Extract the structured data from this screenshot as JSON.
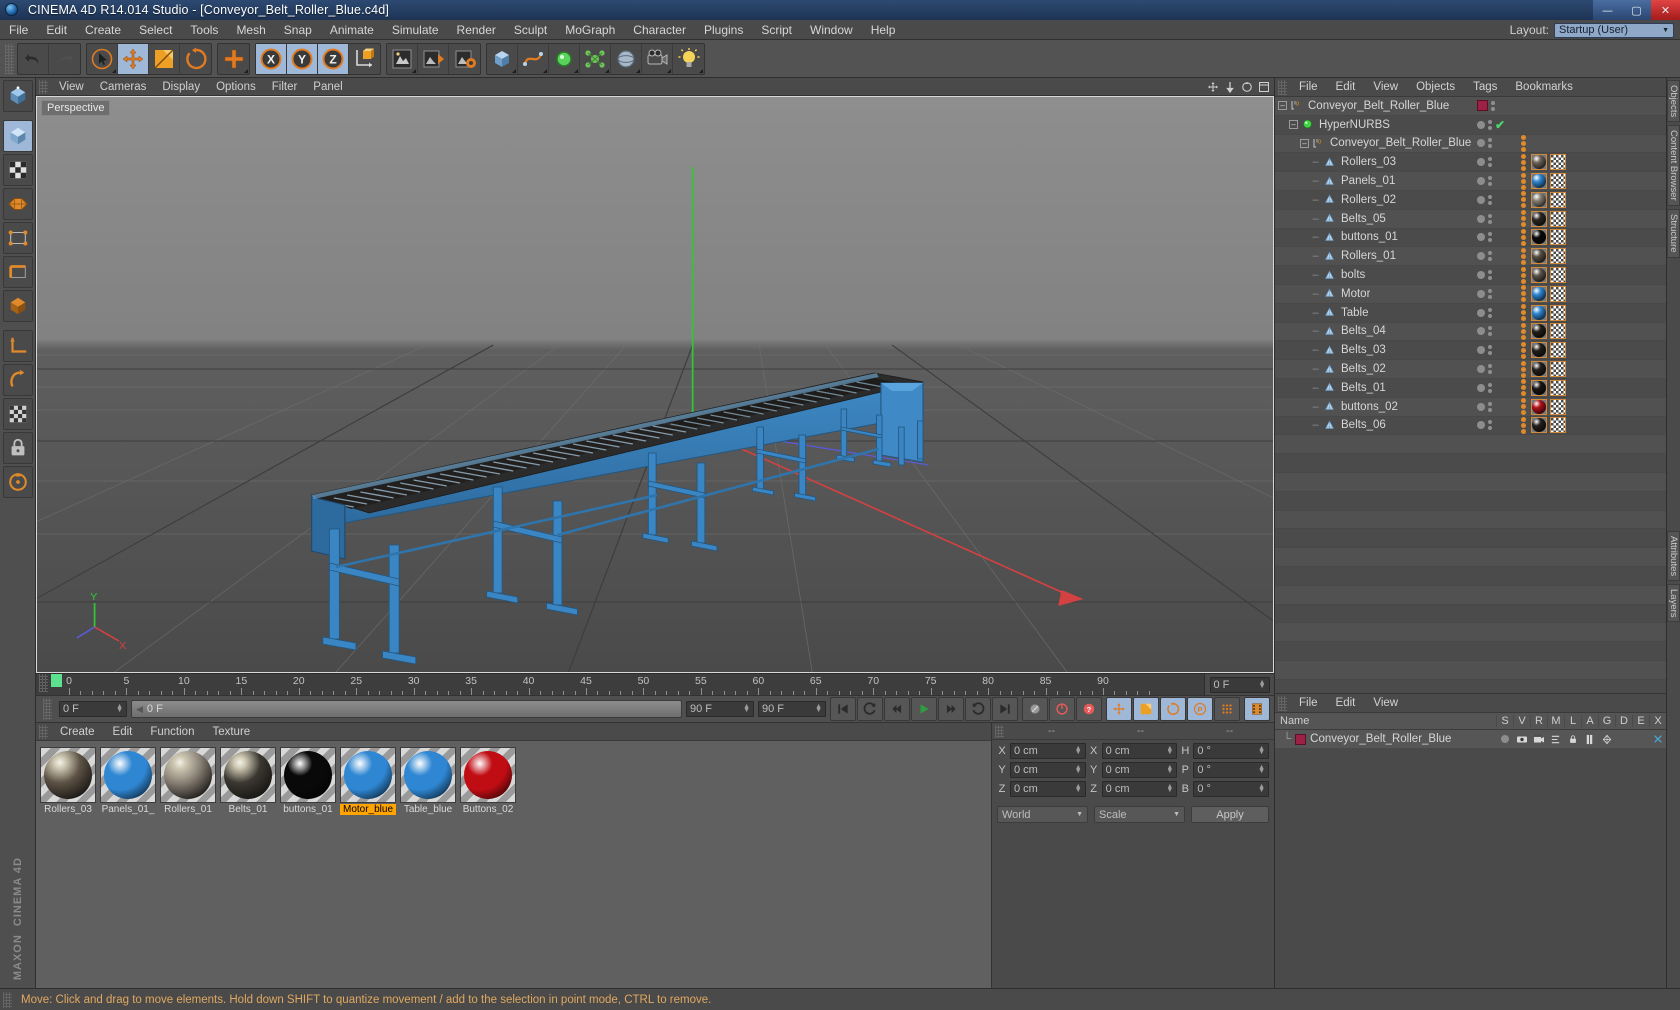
{
  "titlebar": {
    "title": "CINEMA 4D R14.014 Studio - [Conveyor_Belt_Roller_Blue.c4d]",
    "minimize": "—",
    "maximize": "▢",
    "close": "✕"
  },
  "menubar": {
    "items": [
      "File",
      "Edit",
      "Create",
      "Select",
      "Tools",
      "Mesh",
      "Snap",
      "Animate",
      "Simulate",
      "Render",
      "Sculpt",
      "MoGraph",
      "Character",
      "Plugins",
      "Script",
      "Window",
      "Help"
    ],
    "layout_label": "Layout:",
    "layout_value": "Startup (User)"
  },
  "viewport": {
    "menu": [
      "View",
      "Cameras",
      "Display",
      "Options",
      "Filter",
      "Panel"
    ],
    "perspective_label": "Perspective",
    "axis_y": "Y",
    "axis_x": "X"
  },
  "timeline": {
    "labels": [
      "0",
      "5",
      "10",
      "15",
      "20",
      "25",
      "30",
      "35",
      "40",
      "45",
      "50",
      "55",
      "60",
      "65",
      "70",
      "75",
      "80",
      "85",
      "90"
    ],
    "end_field": "0 F"
  },
  "transport": {
    "current_frame": "0 F",
    "scrub_value": "0 F",
    "range_end": "90 F",
    "range_end2": "90 F"
  },
  "material_manager": {
    "menu": [
      "Create",
      "Edit",
      "Function",
      "Texture"
    ],
    "materials": [
      {
        "name": "Rollers_03",
        "color": "#5d5245",
        "selected": false,
        "kind": "metal"
      },
      {
        "name": "Panels_01_",
        "color": "#2f86d2",
        "selected": false,
        "kind": "plastic"
      },
      {
        "name": "Rollers_01",
        "color": "#8a8176",
        "selected": false,
        "kind": "metal"
      },
      {
        "name": "Belts_01",
        "color": "#3b3832",
        "selected": false,
        "kind": "metal"
      },
      {
        "name": "buttons_01",
        "color": "#090909",
        "selected": false,
        "kind": "plastic"
      },
      {
        "name": "Motor_blue",
        "color": "#2f86d2",
        "selected": true,
        "kind": "plastic"
      },
      {
        "name": "Table_blue",
        "color": "#2f86d2",
        "selected": false,
        "kind": "plastic"
      },
      {
        "name": "Buttons_02",
        "color": "#c00d14",
        "selected": false,
        "kind": "plastic"
      }
    ]
  },
  "coordinates": {
    "header": [
      "--",
      "--",
      "--"
    ],
    "rows": [
      {
        "a1": "X",
        "v1": "0 cm",
        "a2": "X",
        "v2": "0 cm",
        "a3": "H",
        "v3": "0 °"
      },
      {
        "a1": "Y",
        "v1": "0 cm",
        "a2": "Y",
        "v2": "0 cm",
        "a3": "P",
        "v3": "0 °"
      },
      {
        "a1": "Z",
        "v1": "0 cm",
        "a2": "Z",
        "v2": "0 cm",
        "a3": "B",
        "v3": "0 °"
      }
    ],
    "space": "World",
    "mode": "Scale",
    "apply": "Apply"
  },
  "object_manager": {
    "menu": [
      "File",
      "Edit",
      "View",
      "Objects",
      "Tags",
      "Bookmarks"
    ],
    "rows": [
      {
        "label": "Conveyor_Belt_Roller_Blue",
        "indent": 0,
        "icon": "null-object",
        "twirl": true,
        "swatch": "#9c2145",
        "check": false,
        "tags": []
      },
      {
        "label": "HyperNURBS",
        "indent": 1,
        "icon": "hypernurbs",
        "twirl": true,
        "swatch": "",
        "check": true,
        "tags": []
      },
      {
        "label": "Conveyor_Belt_Roller_Blue",
        "indent": 2,
        "icon": "null-object",
        "twirl": true,
        "swatch": "",
        "check": false,
        "tags": [
          "dots"
        ]
      },
      {
        "label": "Rollers_03",
        "indent": 3,
        "icon": "polygon",
        "twirl": false,
        "swatch": "",
        "check": false,
        "tags": [
          "dots",
          "mat:#6b6258",
          "check"
        ]
      },
      {
        "label": "Panels_01",
        "indent": 3,
        "icon": "polygon",
        "twirl": false,
        "swatch": "",
        "check": false,
        "tags": [
          "dots",
          "mat:#2f86d2",
          "check"
        ]
      },
      {
        "label": "Rollers_02",
        "indent": 3,
        "icon": "polygon",
        "twirl": false,
        "swatch": "",
        "check": false,
        "tags": [
          "dots",
          "mat:#8a8176",
          "check"
        ]
      },
      {
        "label": "Belts_05",
        "indent": 3,
        "icon": "polygon",
        "twirl": false,
        "swatch": "",
        "check": false,
        "tags": [
          "dots",
          "mat:#2b2823",
          "check"
        ]
      },
      {
        "label": "buttons_01",
        "indent": 3,
        "icon": "polygon",
        "twirl": false,
        "swatch": "",
        "check": false,
        "tags": [
          "dots",
          "mat:#0a0a0a",
          "check"
        ]
      },
      {
        "label": "Rollers_01",
        "indent": 3,
        "icon": "polygon",
        "twirl": false,
        "swatch": "",
        "check": false,
        "tags": [
          "dots",
          "mat:#584f44",
          "check"
        ]
      },
      {
        "label": "bolts",
        "indent": 3,
        "icon": "polygon",
        "twirl": false,
        "swatch": "",
        "check": false,
        "tags": [
          "dots",
          "mat:#5a5248",
          "check"
        ]
      },
      {
        "label": "Motor",
        "indent": 3,
        "icon": "polygon",
        "twirl": false,
        "swatch": "",
        "check": false,
        "tags": [
          "dots",
          "mat:#2f86d2",
          "check"
        ]
      },
      {
        "label": "Table",
        "indent": 3,
        "icon": "polygon",
        "twirl": false,
        "swatch": "",
        "check": false,
        "tags": [
          "dots",
          "mat:#2f86d2",
          "check"
        ]
      },
      {
        "label": "Belts_04",
        "indent": 3,
        "icon": "polygon",
        "twirl": false,
        "swatch": "",
        "check": false,
        "tags": [
          "dots",
          "mat:#23201c",
          "check"
        ]
      },
      {
        "label": "Belts_03",
        "indent": 3,
        "icon": "polygon",
        "twirl": false,
        "swatch": "",
        "check": false,
        "tags": [
          "dots",
          "mat:#23201c",
          "check"
        ]
      },
      {
        "label": "Belts_02",
        "indent": 3,
        "icon": "polygon",
        "twirl": false,
        "swatch": "",
        "check": false,
        "tags": [
          "dots",
          "mat:#23201c",
          "check"
        ]
      },
      {
        "label": "Belts_01",
        "indent": 3,
        "icon": "polygon",
        "twirl": false,
        "swatch": "",
        "check": false,
        "tags": [
          "dots",
          "mat:#1a1714",
          "check"
        ]
      },
      {
        "label": "buttons_02",
        "indent": 3,
        "icon": "polygon",
        "twirl": false,
        "swatch": "",
        "check": false,
        "tags": [
          "dots",
          "mat:#b0111a",
          "check"
        ]
      },
      {
        "label": "Belts_06",
        "indent": 3,
        "icon": "polygon",
        "twirl": false,
        "swatch": "",
        "check": false,
        "tags": [
          "dots",
          "mat:#23201c",
          "check"
        ]
      }
    ]
  },
  "layer_manager": {
    "menu": [
      "File",
      "Edit",
      "View"
    ],
    "columns": [
      "Name",
      "S",
      "V",
      "R",
      "M",
      "L",
      "A",
      "G",
      "D",
      "E",
      "X"
    ],
    "row_label": "Conveyor_Belt_Roller_Blue",
    "row_color": "#9c2145"
  },
  "right_tabs": [
    "Objects",
    "Content Browser",
    "Structure",
    "Attributes",
    "Layers"
  ],
  "statusbar": {
    "text": "Move: Click and drag to move elements. Hold down SHIFT to quantize movement / add to the selection in point mode, CTRL to remove."
  },
  "colors": {
    "accent_orange": "#e08a2a",
    "selection_blue": "#9fb8d8",
    "highlight_yellow": "#ffa400",
    "layer_red": "#9c2145"
  }
}
